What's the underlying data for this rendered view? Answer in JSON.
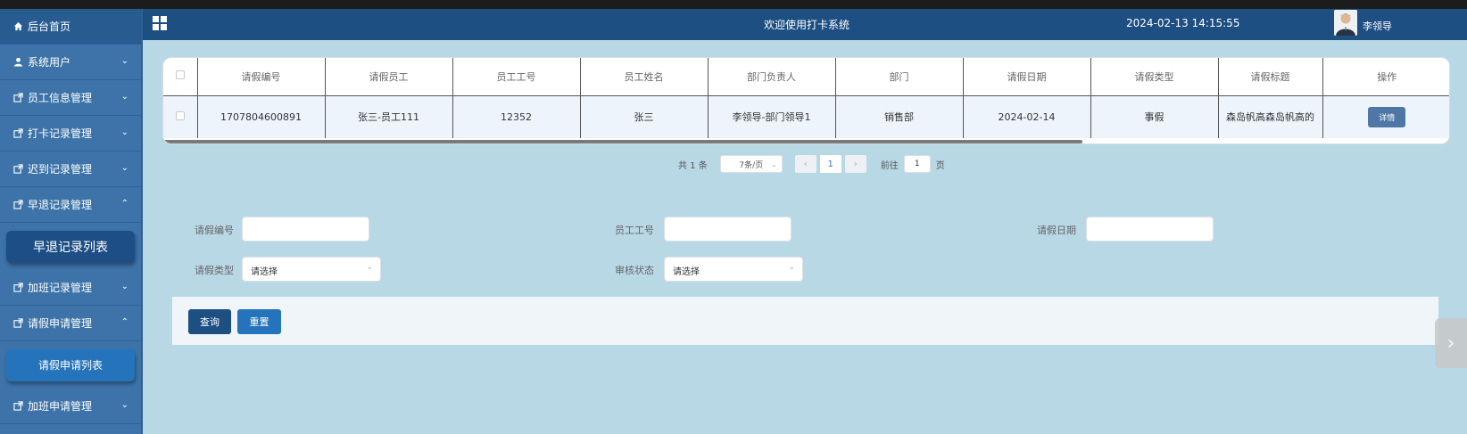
{
  "sidebar": {
    "items": [
      {
        "label": "后台首页",
        "icon": "home-icon"
      },
      {
        "label": "系统用户",
        "icon": "user-icon",
        "chevron": "down"
      },
      {
        "label": "员工信息管理",
        "icon": "external-link-icon",
        "chevron": "down"
      },
      {
        "label": "打卡记录管理",
        "icon": "external-link-icon",
        "chevron": "down"
      },
      {
        "label": "迟到记录管理",
        "icon": "external-link-icon",
        "chevron": "down"
      },
      {
        "label": "早退记录管理",
        "icon": "external-link-icon",
        "chevron": "up"
      },
      {
        "label": "早退记录列表",
        "submenu": true
      },
      {
        "label": "加班记录管理",
        "icon": "external-link-icon",
        "chevron": "down"
      },
      {
        "label": "请假申请管理",
        "icon": "external-link-icon",
        "chevron": "up"
      },
      {
        "label": "请假申请列表",
        "submenu": true
      },
      {
        "label": "加班申请管理",
        "icon": "external-link-icon",
        "chevron": "down"
      }
    ]
  },
  "header": {
    "welcome": "欢迎使用打卡系统",
    "datetime": "2024-02-13 14:15:55",
    "username": "李领导"
  },
  "table": {
    "columns": [
      "请假编号",
      "请假员工",
      "员工工号",
      "员工姓名",
      "部门负责人",
      "部门",
      "请假日期",
      "请假类型",
      "请假标题",
      "操作"
    ],
    "rows": [
      {
        "cells": [
          "1707804600891",
          "张三-员工111",
          "12352",
          "张三",
          "李领导-部门领导1",
          "销售部",
          "2024-02-14",
          "事假",
          "森岛帆高森岛帆高的"
        ],
        "action": "详情"
      }
    ]
  },
  "pagination": {
    "total": "共 1 条",
    "page_size": "7条/页",
    "current": "1",
    "goto_prefix": "前往",
    "goto_value": "1",
    "goto_suffix": "页"
  },
  "search": {
    "leave_no_label": "请假编号",
    "emp_no_label": "员工工号",
    "leave_date_label": "请假日期",
    "leave_type_label": "请假类型",
    "leave_type_value": "请选择",
    "review_status_label": "审核状态",
    "review_status_value": "请选择"
  },
  "actions": {
    "query": "查询",
    "reset": "重置"
  }
}
